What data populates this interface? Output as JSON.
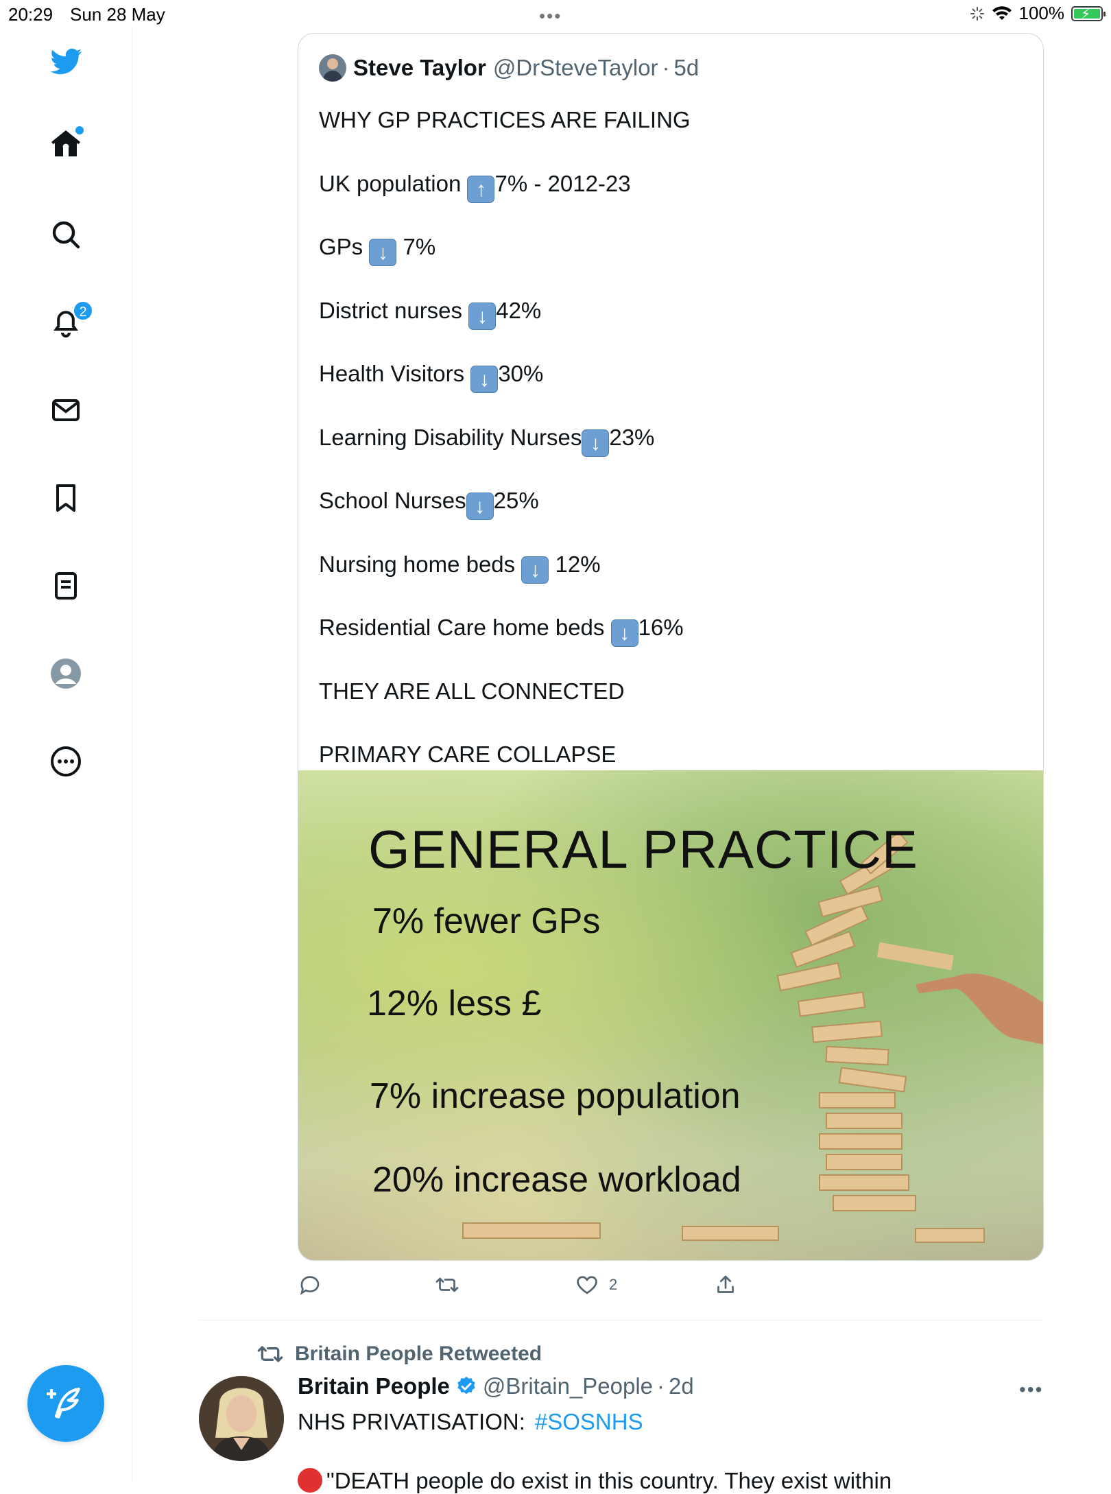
{
  "statusbar": {
    "time": "20:29",
    "date": "Sun 28 May",
    "multitask_dots": "•••",
    "battery": "100%"
  },
  "sidebar": {
    "notifications_badge": "2"
  },
  "quote_tweet": {
    "author_name": "Steve Taylor",
    "author_handle": "@DrSteveTaylor",
    "separator": "·",
    "time": "5d",
    "lines": [
      {
        "pre": "WHY GP PRACTICES ARE FAILING",
        "icon": "",
        "post": ""
      },
      {
        "pre": "UK population ",
        "icon": "up-arrow-emoji",
        "post": "7% - 2012-23"
      },
      {
        "pre": "GPs ",
        "icon": "down-arrow-emoji",
        "post": " 7%"
      },
      {
        "pre": "District nurses ",
        "icon": "down-arrow-emoji",
        "post": "42%"
      },
      {
        "pre": "Health Visitors ",
        "icon": "down-arrow-emoji",
        "post": "30%"
      },
      {
        "pre": "Learning Disability Nurses",
        "icon": "down-arrow-emoji",
        "post": "23%"
      },
      {
        "pre": "School Nurses",
        "icon": "down-arrow-emoji",
        "post": "25%"
      },
      {
        "pre": "Nursing home beds ",
        "icon": "down-arrow-emoji",
        "post": " 12%"
      },
      {
        "pre": "Residential Care home beds ",
        "icon": "down-arrow-emoji",
        "post": "16%"
      },
      {
        "pre": "THEY ARE ALL CONNECTED",
        "icon": "",
        "post": ""
      },
      {
        "pre": "PRIMARY CARE COLLAPSE",
        "icon": "",
        "post": ""
      }
    ],
    "image": {
      "title": "GENERAL PRACTICE",
      "line1": "7% fewer GPs",
      "line2": "12% less £",
      "line3": "7% increase population",
      "line4": "20% increase workload"
    }
  },
  "actions": {
    "like_count": "2"
  },
  "retweet_context": "Britain People Retweeted",
  "tweet": {
    "author_name": "Britain People",
    "author_handle": "@Britain_People",
    "separator": "·",
    "time": "2d",
    "more": "•••",
    "text": "NHS PRIVATISATION:",
    "hashtag": "#SOSNHS",
    "next_line": "\"DEATH people do exist in this country. They exist within"
  },
  "colors": {
    "accent": "#1d9bf0",
    "secondary_text": "#536471",
    "border": "#cfd9de"
  }
}
